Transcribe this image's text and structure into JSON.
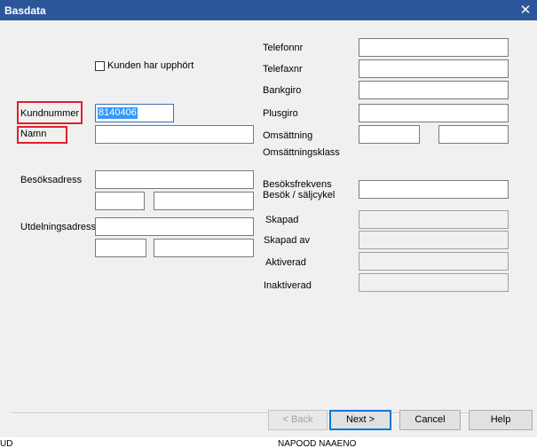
{
  "window": {
    "title": "Basdata",
    "close_icon": "✕"
  },
  "left_form": {
    "checkbox_label": "Kunden har upphört",
    "kundnummer_label": "Kundnummer",
    "kundnummer_value": "8140406",
    "namn_label": "Namn",
    "besoksadress_label": "Besöksadress",
    "utdelningsadress_label": "Utdelningsadress"
  },
  "right_form": {
    "telefonnr_label": "Telefonnr",
    "telefaxnr_label": "Telefaxnr",
    "bankgiro_label": "Bankgiro",
    "plusgiro_label": "Plusgiro",
    "omsattning_label": "Omsättning",
    "omsattningsklass_label": "Omsättningsklass",
    "besoksfrekvens_label": "Besöksfrekvens",
    "besok_saljcykel_label": "Besök / säljcykel",
    "skapad_label": "Skapad",
    "skapad_av_label": "Skapad av",
    "aktiverad_label": "Aktiverad",
    "inaktiverad_label": "Inaktiverad"
  },
  "buttons": {
    "back": "< Back",
    "next": "Next >",
    "cancel": "Cancel",
    "help": "Help"
  },
  "colors": {
    "titlebar": "#2b579a",
    "highlight": "#e0202a",
    "selection": "#3399ff"
  },
  "background_partial_text": {
    "left": "UD",
    "middle": "NAPOOD NAAENO"
  }
}
